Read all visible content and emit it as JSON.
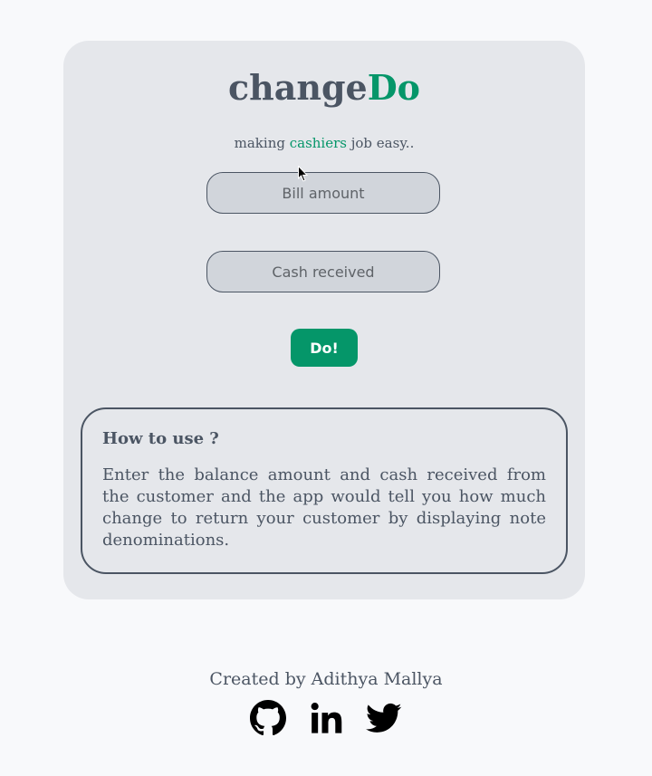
{
  "app": {
    "title_main": "change",
    "title_accent": "Do",
    "tagline_before": "making ",
    "tagline_accent": "cashiers",
    "tagline_after": " job easy.."
  },
  "form": {
    "bill_placeholder": "Bill amount",
    "bill_value": "",
    "cash_placeholder": "Cash received",
    "cash_value": "",
    "submit_label": "Do!"
  },
  "howto": {
    "heading": "How to use ?",
    "body": "Enter the balance amount and cash received from the customer and the app would tell you how much change to return your customer by displaying note denominations."
  },
  "footer": {
    "credit": "Created by Adithya Mallya",
    "icons": [
      "github-icon",
      "linkedin-icon",
      "twitter-icon"
    ]
  },
  "colors": {
    "accent": "#059669",
    "text": "#4b5563",
    "card": "#e5e7eb",
    "input": "#d1d5db",
    "page": "#f8f9fb"
  }
}
